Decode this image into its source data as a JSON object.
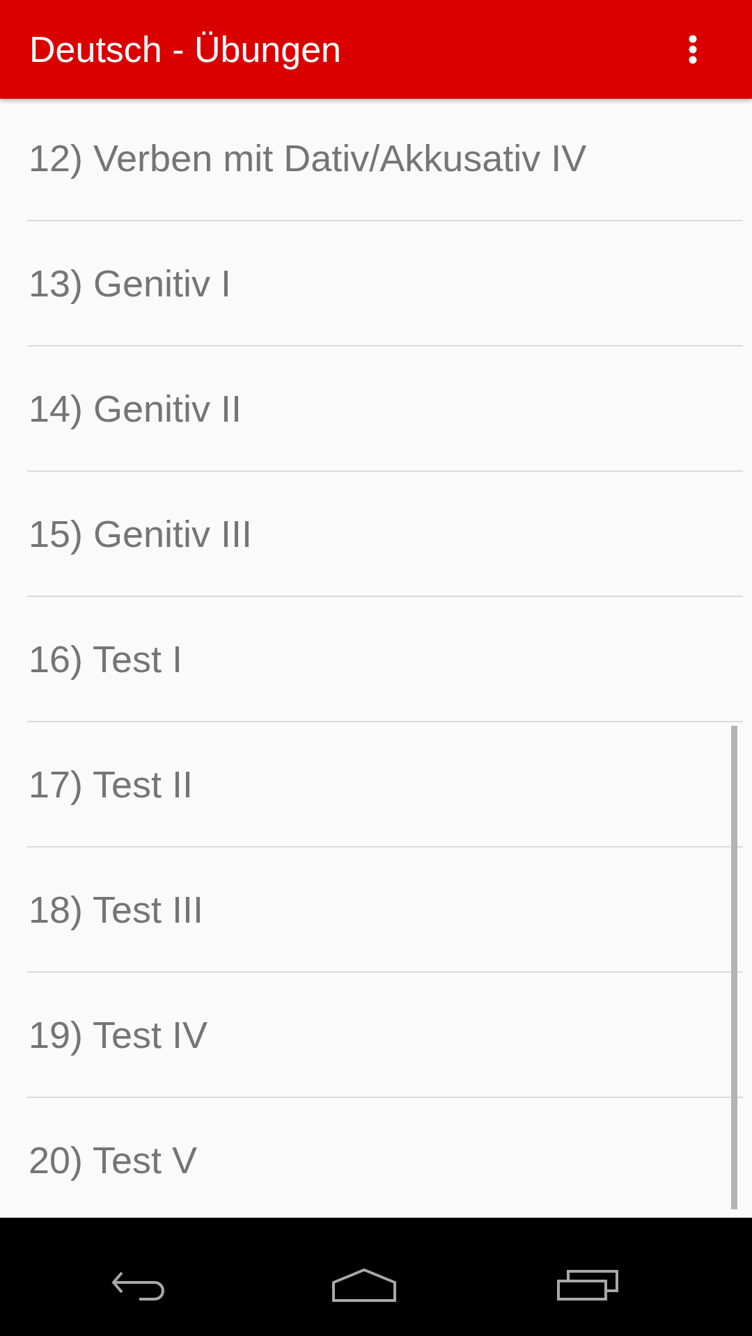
{
  "app_bar": {
    "title": "Deutsch - Übungen"
  },
  "exercises": [
    "12) Verben mit Dativ/Akkusativ IV",
    "13) Genitiv I",
    "14) Genitiv II",
    "15) Genitiv III",
    "16) Test I",
    "17) Test II",
    "18) Test III",
    "19) Test IV",
    "20) Test V"
  ]
}
